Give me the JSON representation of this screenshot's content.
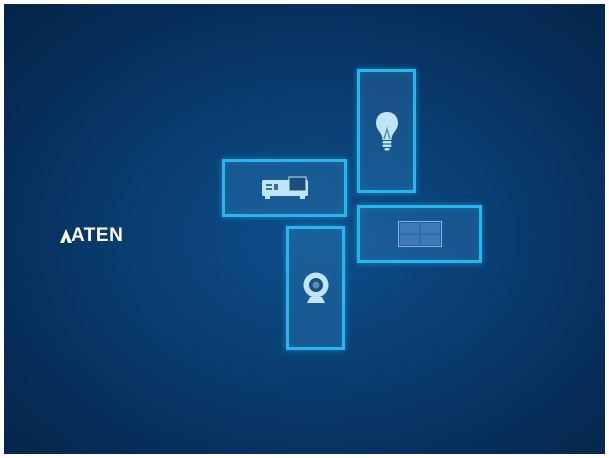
{
  "brand": {
    "logo_text": "ATEN"
  },
  "tiles": [
    {
      "id": "lighting",
      "icon": "lightbulb-icon"
    },
    {
      "id": "projector",
      "icon": "projector-icon"
    },
    {
      "id": "display",
      "icon": "video-wall-icon"
    },
    {
      "id": "camera",
      "icon": "webcam-icon"
    }
  ],
  "colors": {
    "background": "#0a3f74",
    "tile_border": "#29b6ee",
    "icon": "#bfe6f7"
  }
}
